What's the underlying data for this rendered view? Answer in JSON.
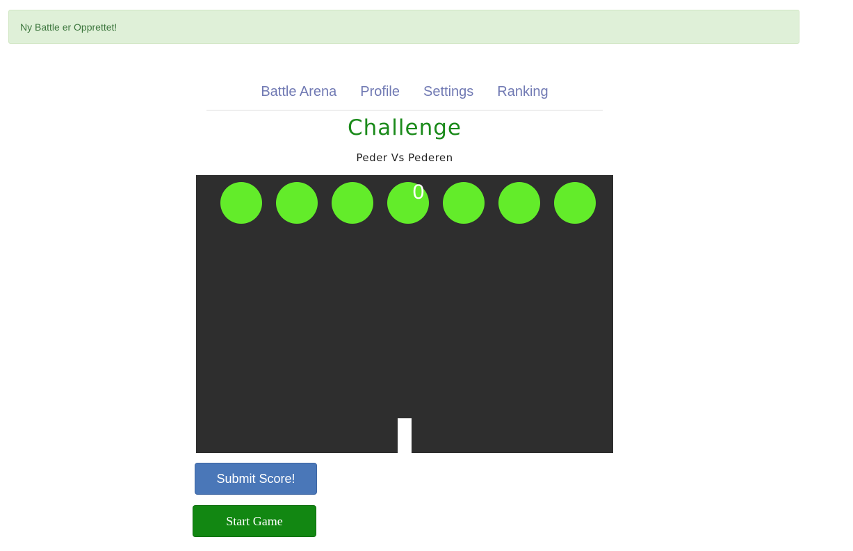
{
  "alert": {
    "text": "Ny Battle er Opprettet!"
  },
  "nav": {
    "items": [
      {
        "label": "Battle Arena"
      },
      {
        "label": "Profile"
      },
      {
        "label": "Settings"
      },
      {
        "label": "Ranking"
      }
    ]
  },
  "page": {
    "title": "Challenge",
    "subtitle": "Peder Vs Pederen"
  },
  "game": {
    "score": "0",
    "ball_color": "#63ec2a",
    "background_color": "#2e2e2e",
    "ball_count": 7
  },
  "buttons": {
    "submit_label": "Submit Score!",
    "start_label": "Start Game"
  },
  "colors": {
    "alert_bg": "#dff0d8",
    "alert_text": "#3c763d",
    "nav_link": "#7079b3",
    "title": "#1a8a1a",
    "submit_button": "#4a77b8",
    "start_button": "#128712"
  }
}
